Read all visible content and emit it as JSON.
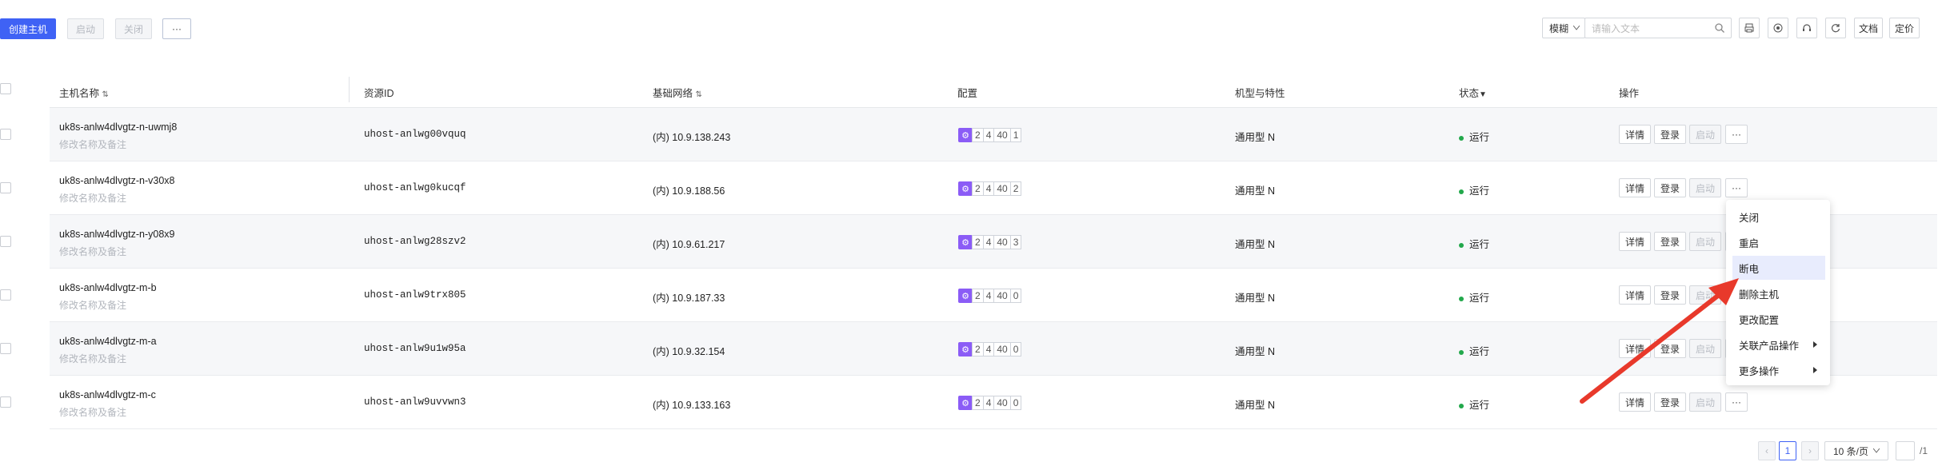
{
  "toolbar": {
    "create": "创建主机",
    "start": "启动",
    "close": "关闭",
    "more": "···",
    "search_mode": "模糊",
    "search_placeholder": "请输入文本",
    "docs": "文档",
    "pricing": "定价"
  },
  "table": {
    "headers": {
      "name": "主机名称",
      "resource_id": "资源ID",
      "network": "基础网络",
      "config": "配置",
      "model": "机型与特性",
      "status": "状态",
      "ops": "操作"
    },
    "rows": [
      {
        "name": "uk8s-anlw4dlvgtz-n-uwmj8",
        "note": "修改名称及备注",
        "id": "uhost-anlwg00vquq",
        "ip": "(内) 10.9.138.243",
        "cfg": [
          "2",
          "4",
          "40",
          "1"
        ],
        "model": "通用型 N",
        "status": "运行"
      },
      {
        "name": "uk8s-anlw4dlvgtz-n-v30x8",
        "note": "修改名称及备注",
        "id": "uhost-anlwg0kucqf",
        "ip": "(内) 10.9.188.56",
        "cfg": [
          "2",
          "4",
          "40",
          "2"
        ],
        "model": "通用型 N",
        "status": "运行"
      },
      {
        "name": "uk8s-anlw4dlvgtz-n-y08x9",
        "note": "修改名称及备注",
        "id": "uhost-anlwg28szv2",
        "ip": "(内) 10.9.61.217",
        "cfg": [
          "2",
          "4",
          "40",
          "3"
        ],
        "model": "通用型 N",
        "status": "运行"
      },
      {
        "name": "uk8s-anlw4dlvgtz-m-b",
        "note": "修改名称及备注",
        "id": "uhost-anlw9trx805",
        "ip": "(内) 10.9.187.33",
        "cfg": [
          "2",
          "4",
          "40",
          "0"
        ],
        "model": "通用型 N",
        "status": "运行"
      },
      {
        "name": "uk8s-anlw4dlvgtz-m-a",
        "note": "修改名称及备注",
        "id": "uhost-anlw9u1w95a",
        "ip": "(内) 10.9.32.154",
        "cfg": [
          "2",
          "4",
          "40",
          "0"
        ],
        "model": "通用型 N",
        "status": "运行"
      },
      {
        "name": "uk8s-anlw4dlvgtz-m-c",
        "note": "修改名称及备注",
        "id": "uhost-anlw9uvvwn3",
        "ip": "(内) 10.9.133.163",
        "cfg": [
          "2",
          "4",
          "40",
          "0"
        ],
        "model": "通用型 N",
        "status": "运行"
      }
    ],
    "row_actions": {
      "detail": "详情",
      "login": "登录",
      "start": "启动",
      "more": "···"
    }
  },
  "dropdown": {
    "items": [
      "关闭",
      "重启",
      "断电",
      "删除主机",
      "更改配置",
      "关联产品操作",
      "更多操作"
    ],
    "highlighted": "断电"
  },
  "pagination": {
    "prev": "‹",
    "current": "1",
    "next": "›",
    "page_size": "10 条/页",
    "total_suffix": "/1"
  },
  "colors": {
    "primary": "#3f62f5",
    "status_running": "#22a84b",
    "config_icon": "#8b5cf6",
    "arrow": "#e8392b"
  }
}
